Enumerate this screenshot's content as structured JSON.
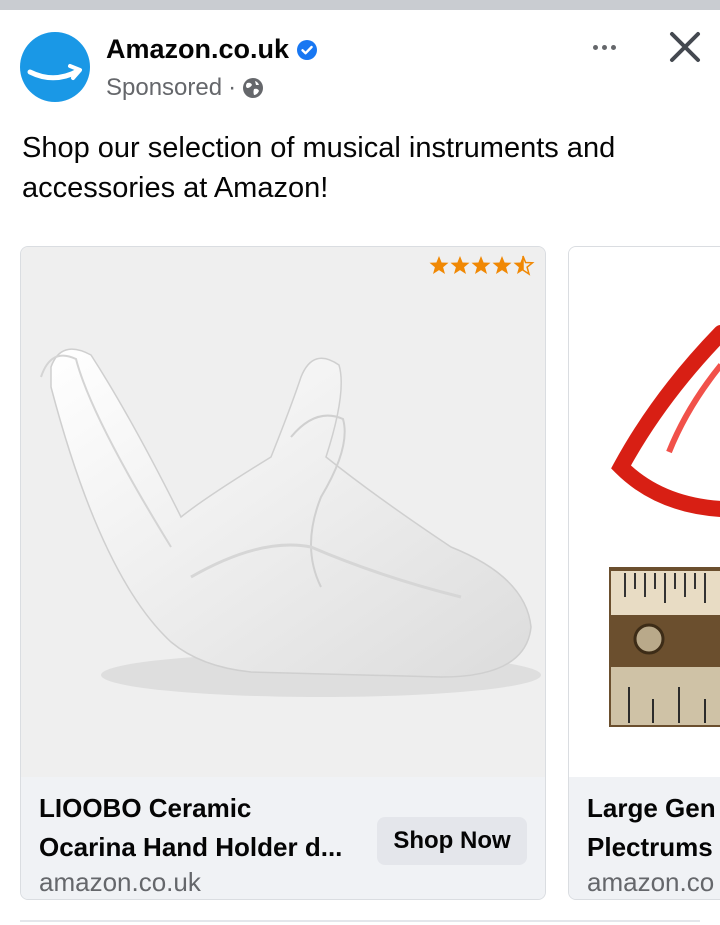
{
  "post": {
    "page_name": "Amazon.co.uk",
    "sponsored": "Sponsored",
    "separator": "·",
    "body_text": "Shop our selection of musical instruments and accessories at Amazon!"
  },
  "colors": {
    "avatar": "#1a98e6",
    "verified": "#1877f2",
    "stars": "#f08804",
    "button_bg": "#e4e6eb"
  },
  "icons": {
    "logo": "amazon-smile-logo",
    "verified": "verified-badge-icon",
    "privacy": "globe-icon",
    "menu": "more-dots-icon",
    "close": "close-icon",
    "rating": "star-rating-icon"
  },
  "cards": [
    {
      "rating": 4.5,
      "title_line1": "LIOOBO Ceramic",
      "title_line2": "Ocarina Hand Holder d...",
      "domain": "amazon.co.uk",
      "cta": "Shop Now"
    },
    {
      "title_line1": "Large Gen",
      "title_line2": "Plectrums",
      "domain": "amazon.co"
    }
  ]
}
